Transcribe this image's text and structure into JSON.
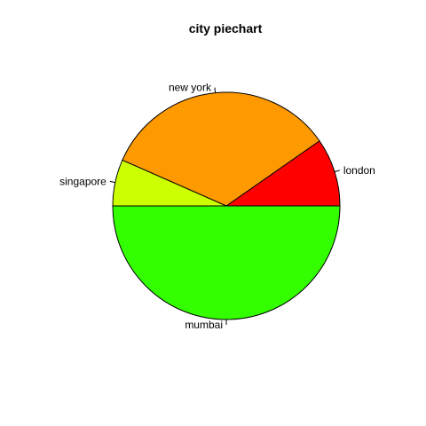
{
  "chart_data": {
    "type": "pie",
    "title": "city piechart",
    "direction": "counterclockwise",
    "start": "3 o'clock",
    "slices": [
      {
        "label": "london",
        "value": 0.097,
        "color": "#FF0000"
      },
      {
        "label": "new york",
        "value": 0.337,
        "color": "#FF9900"
      },
      {
        "label": "singapore",
        "value": 0.066,
        "color": "#CCFF00"
      },
      {
        "label": "mumbai",
        "value": 0.5,
        "color": "#33FF00"
      }
    ]
  }
}
